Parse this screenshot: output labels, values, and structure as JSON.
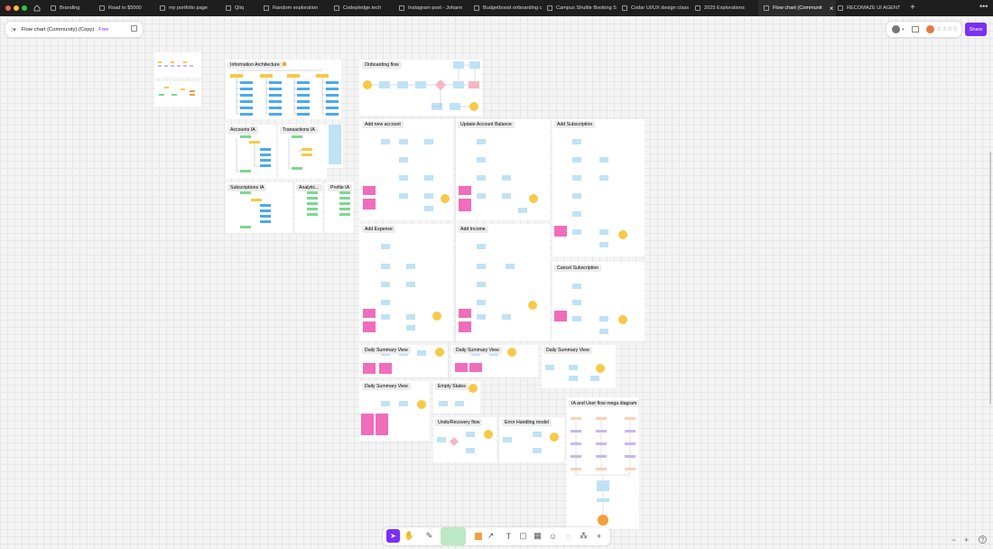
{
  "tabs": [
    {
      "label": "Branding",
      "active": false
    },
    {
      "label": "Road to $5000",
      "active": false
    },
    {
      "label": "my portfolio page",
      "active": false
    },
    {
      "label": "Qliq",
      "active": false
    },
    {
      "label": "Random exploration",
      "active": false
    },
    {
      "label": "Codepledge.tech",
      "active": false
    },
    {
      "label": "Instagram post - Johann",
      "active": false
    },
    {
      "label": "Budgetboost onboarding c",
      "active": false
    },
    {
      "label": "Campus Shuttle Booking S",
      "active": false
    },
    {
      "label": "Codar UI/UX design class",
      "active": false
    },
    {
      "label": "2025 Explorations",
      "active": false
    },
    {
      "label": "Flow chart (Communit",
      "active": true
    },
    {
      "label": "RECOMAZE UI AGENT",
      "active": false
    }
  ],
  "file": {
    "name": "Flow chart (Community) (Copy)",
    "plan_badge": "Free"
  },
  "share_label": "Share",
  "sections": {
    "info_arch": "Information Architecture",
    "onboarding": "Onboarding flow",
    "accounts_ia": "Accounts IA",
    "transactions_ia": "Transactions IA",
    "subscriptions_ia": "Subscriptions IA",
    "analytics": "Analytic...",
    "profile_ia": "Profile IA",
    "add_account": "Add new account",
    "update_balance": "Update Account Balance",
    "add_subscription": "Add Subscription",
    "add_expense": "Add Expense",
    "add_income": "Add Income",
    "cancel_subscription": "Cancel Subscription",
    "daily_summary_1": "Daily Summary View",
    "daily_summary_2": "Daily Summary View",
    "daily_summary_3": "Daily Summary View",
    "daily_summary_4": "Daily Summary View",
    "empty_states": "Empty States",
    "undo_recovery": "Undo/Recovery flow",
    "error_handling": "Error Handling model",
    "mega_diagram": "IA and User flow mega diagram"
  },
  "colors": {
    "node_blue": "#bfe2f7",
    "node_yellow": "#f7c948",
    "node_sticky": "#f06dbb",
    "node_green": "#7bd88f",
    "node_orange": "#f59e3b",
    "node_purple": "#c9b6f2",
    "node_peach": "#f7d2b6",
    "accent_purple": "#7b2ff7"
  },
  "icons": {
    "home": "home-icon",
    "menu": "main-menu-icon",
    "more": "more-icon",
    "zoom_out": "minus-icon",
    "zoom_in": "plus-icon",
    "help": "help-icon"
  },
  "toolbar": [
    "move-tool",
    "hand-tool",
    "marker-tool",
    "highlighter-tool",
    "shape-tool",
    "connector-tool",
    "text-tool",
    "section-tool",
    "table-tool",
    "stamp-tool",
    "comment-tool",
    "widgets-tool",
    "more-tools"
  ]
}
